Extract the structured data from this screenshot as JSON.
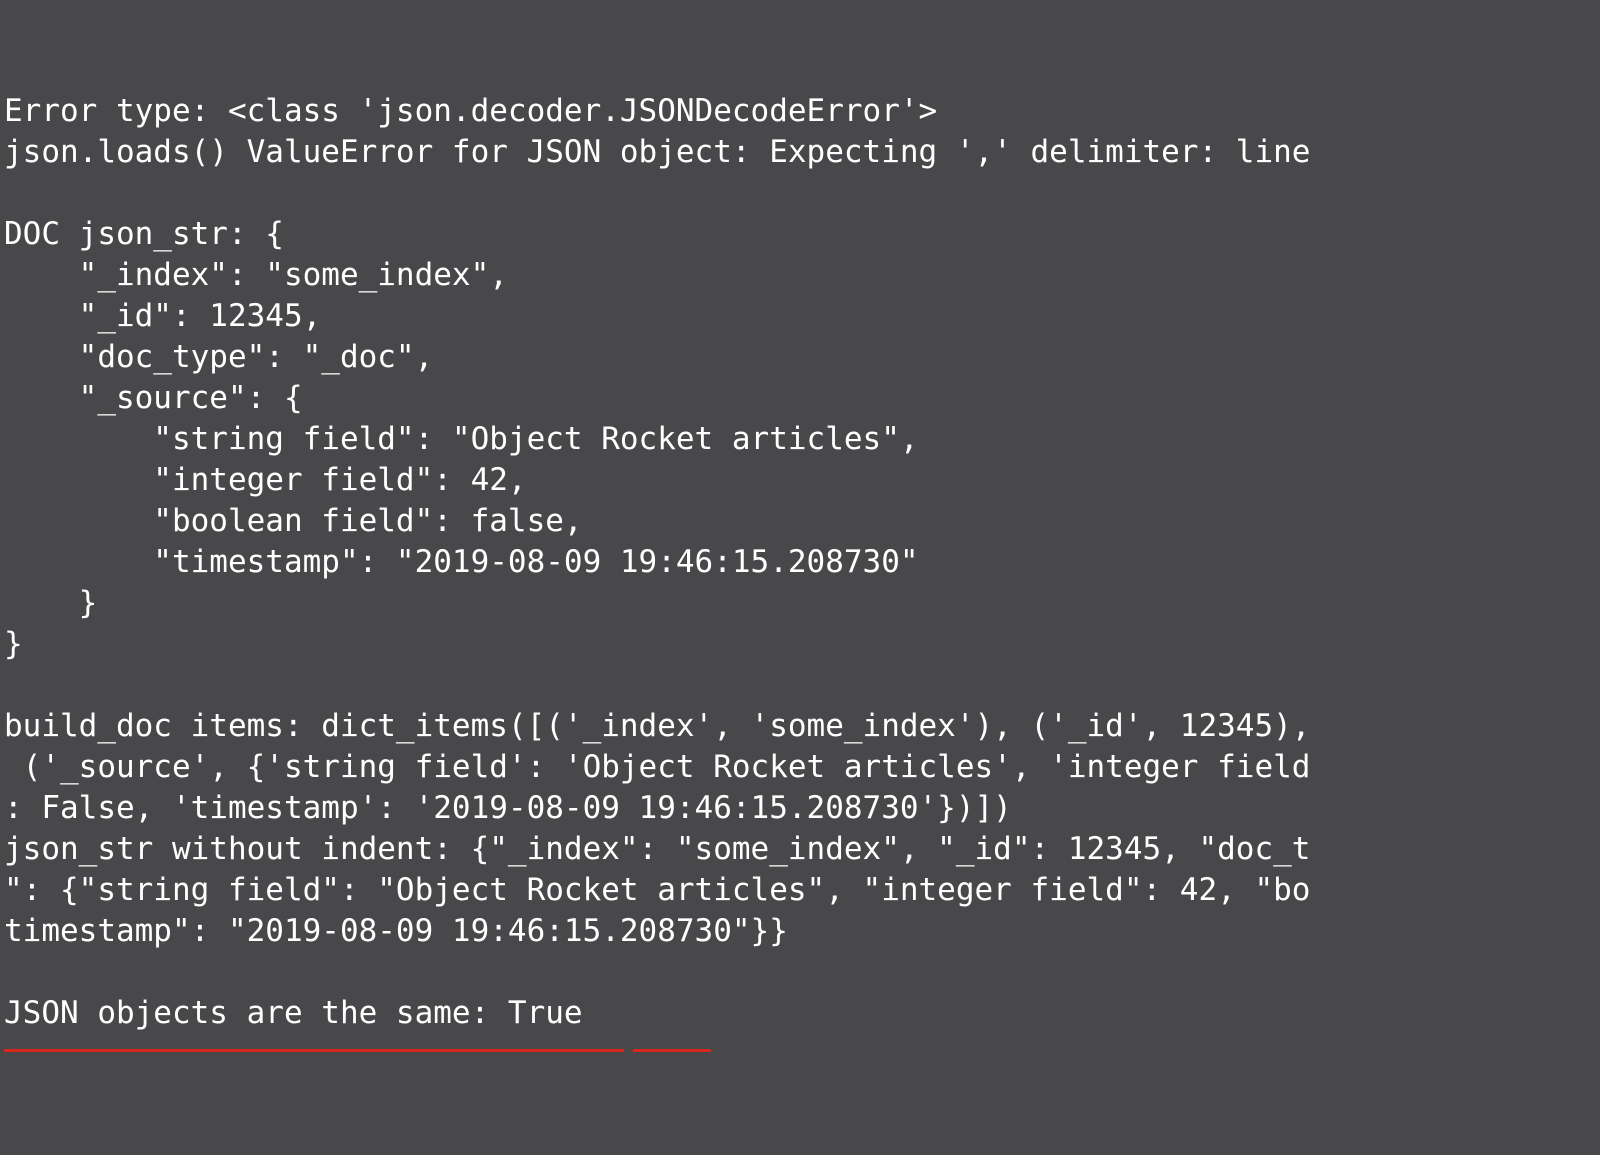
{
  "terminal": {
    "lines": {
      "l1": "Error type: <class 'json.decoder.JSONDecodeError'>",
      "l2": "json.loads() ValueError for JSON object: Expecting ',' delimiter: line",
      "l3": "",
      "l4": "DOC json_str: {",
      "l5": "    \"_index\": \"some_index\",",
      "l6": "    \"_id\": 12345,",
      "l7": "    \"doc_type\": \"_doc\",",
      "l8": "    \"_source\": {",
      "l9": "        \"string field\": \"Object Rocket articles\",",
      "l10": "        \"integer field\": 42,",
      "l11": "        \"boolean field\": false,",
      "l12": "        \"timestamp\": \"2019-08-09 19:46:15.208730\"",
      "l13": "    }",
      "l14": "}",
      "l15": "",
      "l16": "build_doc items: dict_items([('_index', 'some_index'), ('_id', 12345),",
      "l17": " ('_source', {'string field': 'Object Rocket articles', 'integer field",
      "l18": ": False, 'timestamp': '2019-08-09 19:46:15.208730'})])",
      "l19": "json_str without indent: {\"_index\": \"some_index\", \"_id\": 12345, \"doc_t",
      "l20": "\": {\"string field\": \"Object Rocket articles\", \"integer field\": 42, \"bo",
      "l21": "timestamp\": \"2019-08-09 19:46:15.208730\"}}",
      "l22": "",
      "l23": "JSON objects are the same: True"
    }
  }
}
